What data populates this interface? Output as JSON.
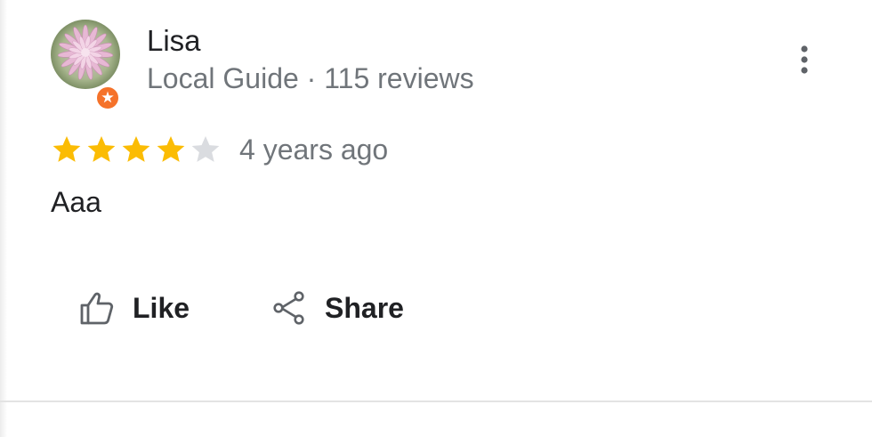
{
  "reviewer": {
    "name": "Lisa",
    "meta": "Local Guide · 115 reviews"
  },
  "review": {
    "rating": 4,
    "max_rating": 5,
    "time": "4 years ago",
    "text": "Aaa"
  },
  "actions": {
    "like_label": "Like",
    "share_label": "Share"
  },
  "icons": {
    "avatar": "flower-avatar",
    "badge": "local-guide-badge-icon",
    "more": "more-vert-icon",
    "like": "thumb-up-icon",
    "share": "share-icon"
  },
  "colors": {
    "star_filled": "#fbbc04",
    "star_empty": "#dadce0",
    "badge": "#f5722a",
    "text_primary": "#202124",
    "text_secondary": "#70757a"
  }
}
